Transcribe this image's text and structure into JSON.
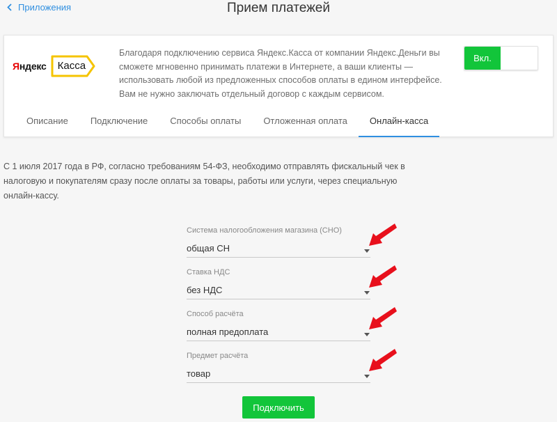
{
  "header": {
    "back_label": "Приложения",
    "title": "Прием платежей"
  },
  "app_card": {
    "logo_brand": "Яндекс",
    "logo_product": "Касса",
    "description": "Благодаря подключению сервиса Яндекс.Касса от компании Яндекс.Деньги вы сможете мгновенно принимать платежи в Интернете, а ваши клиенты — использовать любой из предложенных способов оплаты в едином интерфейсе. Вам не нужно заключать отдельный договор с каждым сервисом.",
    "toggle_label": "Вкл.",
    "toggle_state": "on",
    "accent_color": "#12c53a"
  },
  "tabs": [
    {
      "label": "Описание"
    },
    {
      "label": "Подключение"
    },
    {
      "label": "Способы оплаты"
    },
    {
      "label": "Отложенная оплата"
    },
    {
      "label": "Онлайн-касса"
    }
  ],
  "active_tab": "Онлайн-касса",
  "intro_text": "С 1 июля 2017 года в РФ, согласно требованиям 54-ФЗ, необходимо отправлять фискальный чек в налоговую и покупателям сразу после оплаты за товары, работы или услуги, через специальную онлайн-кассу.",
  "form": {
    "fields": [
      {
        "label": "Система налогообложения магазина (СНО)",
        "value": "общая СН"
      },
      {
        "label": "Ставка НДС",
        "value": "без НДС"
      },
      {
        "label": "Способ расчёта",
        "value": "полная предоплата"
      },
      {
        "label": "Предмет расчёта",
        "value": "товар"
      }
    ],
    "submit_label": "Подключить"
  },
  "icons": {
    "back": "chevron-left-icon",
    "annotation": "red-arrow-icon"
  },
  "colors": {
    "link": "#2f8fe0",
    "annotation_arrow": "#e8101c",
    "logo_frame": "#f5c400"
  }
}
